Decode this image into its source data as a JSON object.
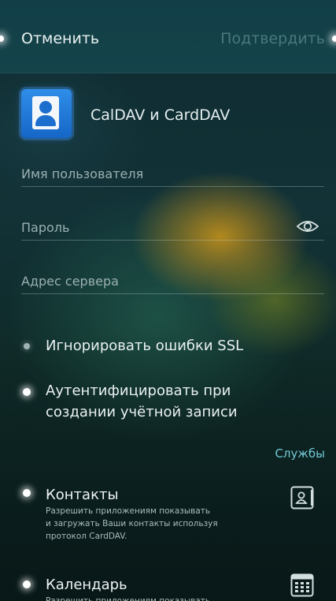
{
  "header": {
    "cancel_label": "Отменить",
    "confirm_label": "Подтвердить"
  },
  "account": {
    "title": "CalDAV и CardDAV"
  },
  "fields": {
    "username_placeholder": "Имя пользователя",
    "password_placeholder": "Пароль",
    "server_placeholder": "Адрес сервера"
  },
  "options": {
    "ignore_ssl_label": "Игнорировать ошибки SSL",
    "ignore_ssl_enabled": false,
    "authenticate_label_line1": "Аутентифицировать при",
    "authenticate_label_line2": "создании учётной записи",
    "authenticate_enabled": true
  },
  "services": {
    "section_label": "Службы",
    "contacts": {
      "title": "Контакты",
      "desc_line1": "Разрешить приложениям показывать",
      "desc_line2": "и загружать Ваши контакты используя",
      "desc_line3": "протокол CardDAV.",
      "icon": "contact-card-icon",
      "enabled": true
    },
    "calendar": {
      "title": "Календарь",
      "desc_line1": "Разрешить приложениям показывать",
      "icon": "calendar-icon",
      "enabled": true
    }
  },
  "colors": {
    "header_bg": "#15434a",
    "link": "#72c9d6",
    "account_icon": "#2f8ee9"
  }
}
